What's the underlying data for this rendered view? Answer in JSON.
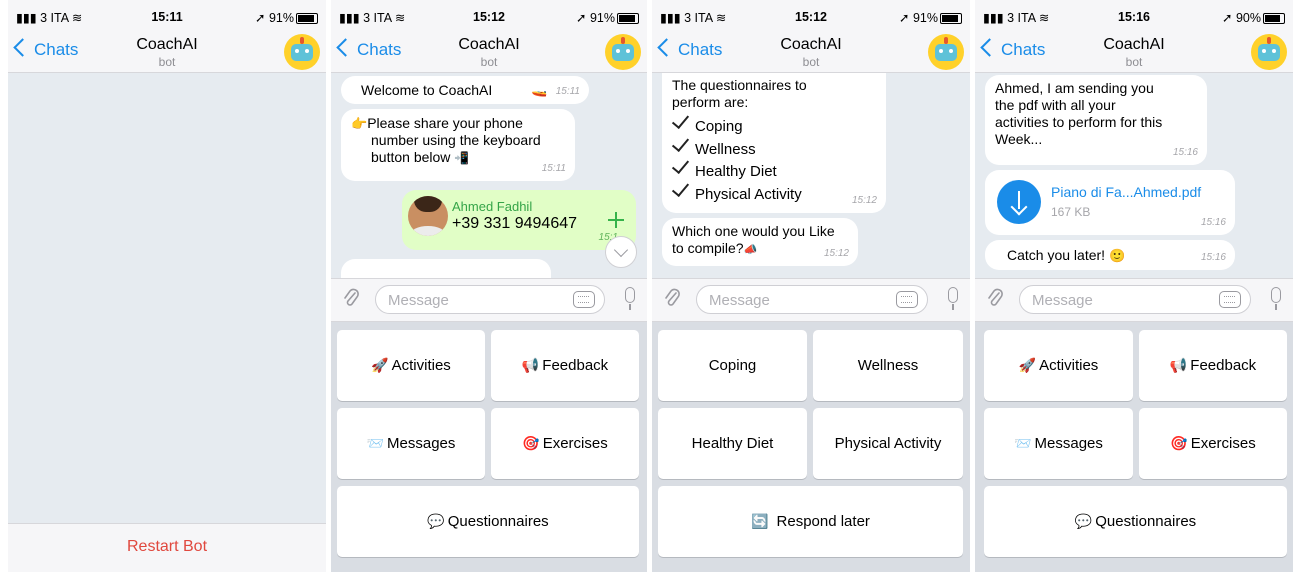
{
  "status": {
    "carrier": "3 ITA",
    "battery_1": "91%",
    "battery_2": "91%",
    "battery_3": "91%",
    "battery_4": "90%",
    "times": [
      "15:11",
      "15:12",
      "15:12",
      "15:16"
    ]
  },
  "nav": {
    "back": "Chats",
    "title": "CoachAI",
    "subtitle": "bot"
  },
  "input": {
    "placeholder": "Message"
  },
  "screen1": {
    "restart": "Restart Bot"
  },
  "screen2": {
    "welcome": "Welcome to CoachAI",
    "welcome_time": "15:11",
    "share_line1": "Please share your phone",
    "share_line2": "number using the keyboard",
    "share_line3": "button below",
    "share_time": "15:11",
    "contact_name": "Ahmed Fadhil",
    "contact_phone": "+39 331 9494647",
    "contact_time": "15:1"
  },
  "screen3": {
    "intro_line1": "The questionnaires to",
    "intro_line2": "perform are:",
    "items": [
      "Coping",
      "Wellness",
      "Healthy Diet",
      "Physical Activity"
    ],
    "list_time": "15:12",
    "ask_line1": "Which one would you Like",
    "ask_line2": "to compile?",
    "ask_time": "15:12"
  },
  "screen4": {
    "msg_line1": "Ahmed, I am sending you",
    "msg_line2": "the pdf with all your",
    "msg_line3": "activities to perform for this",
    "msg_line4": "Week...",
    "msg_time": "15:16",
    "file_name": "Piano di Fa...Ahmed.pdf",
    "file_size": "167 KB",
    "file_time": "15:16",
    "bye": "Catch you later!",
    "bye_time": "15:16"
  },
  "menu_keys": {
    "activities": "Activities",
    "feedback": "Feedback",
    "messages": "Messages",
    "exercises": "Exercises",
    "questionnaires": "Questionnaires"
  },
  "quest_keys": {
    "coping": "Coping",
    "wellness": "Wellness",
    "healthy_diet": "Healthy Diet",
    "physical_activity": "Physical Activity",
    "respond_later": "Respond later"
  },
  "emoji": {
    "rocket": "🚀",
    "feedback": "📢",
    "messages": "📨",
    "target": "🎯",
    "speech": "💬",
    "refresh": "🔄",
    "point": "👉",
    "phone": "📲",
    "megaphone": "📣",
    "smile": "🙂",
    "boat": "🚤"
  }
}
